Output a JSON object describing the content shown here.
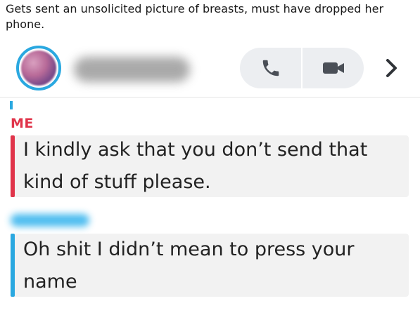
{
  "caption": "Gets sent an unsolicited picture of breasts, must have dropped her phone.",
  "header": {
    "icons": {
      "avatar": "friend-avatar",
      "call": "phone-icon",
      "video": "video-camera-icon",
      "more": "chevron-right-icon"
    },
    "accent_color": "#2aa8e0"
  },
  "messages": [
    {
      "sender_label": "ME",
      "sender_color": "#e0344a",
      "text": "I kindly ask that you don’t send that kind of stuff please."
    },
    {
      "sender_color": "#2aa8e0",
      "text": "Oh shit I didn’t mean to press your name"
    }
  ]
}
